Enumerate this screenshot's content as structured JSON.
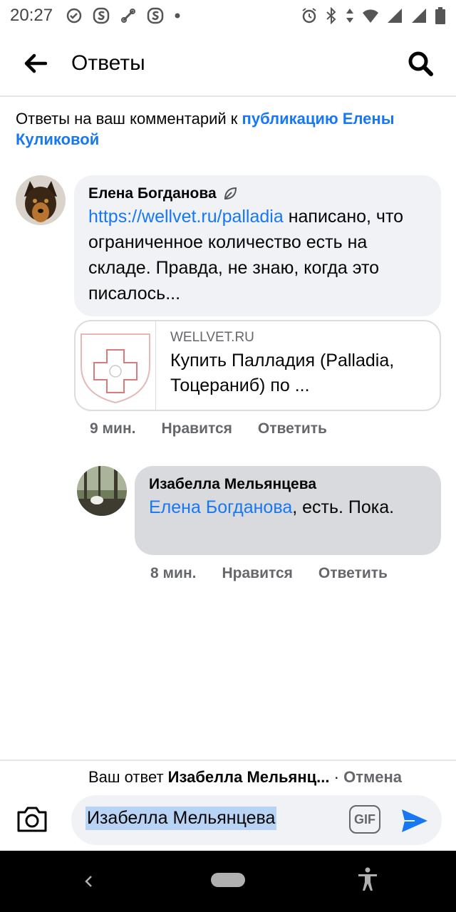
{
  "status_bar": {
    "time": "20:27",
    "left_icons": [
      "check-circle-icon",
      "s-app-icon",
      "link-icon",
      "s-app-icon",
      "dot-icon"
    ],
    "right_icons": [
      "alarm-icon",
      "bluetooth-icon",
      "data-arrows-icon",
      "wifi-icon",
      "signal-icon",
      "signal-icon",
      "battery-icon"
    ]
  },
  "header": {
    "title": "Ответы",
    "back_icon": "arrow-left-icon",
    "search_icon": "search-icon"
  },
  "context": {
    "prefix": "Ответы на ваш комментарий к ",
    "link_text": "публикацию Елены Куликовой"
  },
  "comments": [
    {
      "author": "Елена Богданова",
      "badge_icon": "leaf-badge-icon",
      "link": "https://wellvet.ru/palladia",
      "text": " написано, что ограниченное количество есть на складе. Правда, не знаю, когда это писалось...",
      "link_preview": {
        "domain": "WELLVET.RU",
        "title": "Купить Палладия (Palladia, Тоцераниб) по ..."
      },
      "time": "9 мин.",
      "like_label": "Нравится",
      "reply_label": "Ответить"
    },
    {
      "author": "Изабелла Мельянцева",
      "mention": "Елена Богданова",
      "text": ", есть. Пока.",
      "time": "8 мин.",
      "like_label": "Нравится",
      "reply_label": "Ответить"
    }
  ],
  "reply_bar": {
    "prefix": "Ваш ответ ",
    "target": "Изабелла Мельянц...",
    "separator": " · ",
    "cancel_label": "Отмена",
    "input_value": "Изабелла Мельянцева",
    "gif_label": "GIF",
    "camera_icon": "camera-icon",
    "send_icon": "send-icon"
  },
  "colors": {
    "accent": "#1877f2",
    "bubble": "#f0f2f5",
    "bubble_selected": "#d8dade",
    "meta_text": "#65676b"
  }
}
